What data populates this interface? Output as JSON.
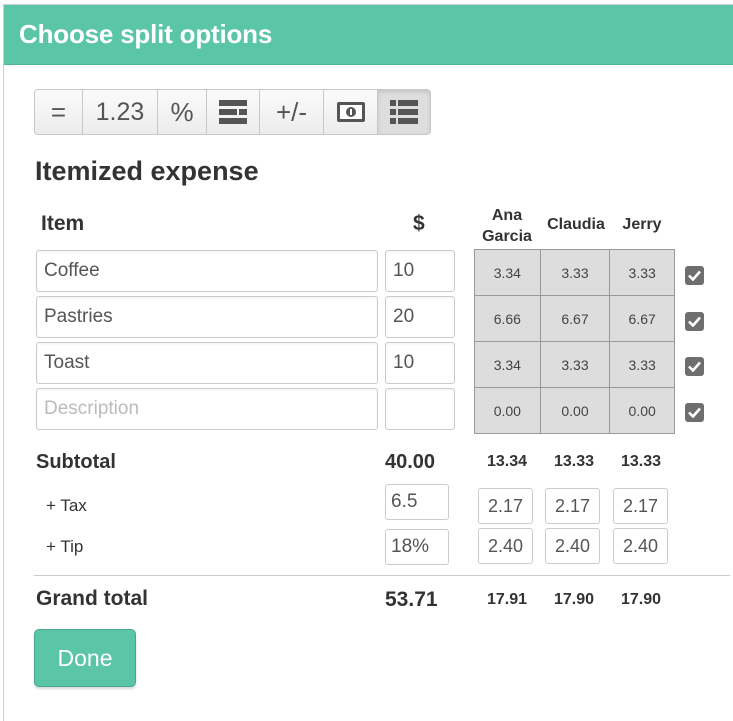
{
  "header": {
    "title": "Choose split options"
  },
  "toolbar": {
    "buttons": [
      {
        "label": "=",
        "icon": "equal-split-icon"
      },
      {
        "label": "1.23",
        "icon": "exact-amounts-icon"
      },
      {
        "label": "%",
        "icon": "percent-icon"
      },
      {
        "label": "",
        "icon": "shares-icon"
      },
      {
        "label": "+/-",
        "icon": "adjustment-icon"
      },
      {
        "label": "",
        "icon": "money-bill-icon"
      },
      {
        "label": "",
        "icon": "itemized-list-icon",
        "active": true
      }
    ]
  },
  "section_title": "Itemized expense",
  "table": {
    "headers": {
      "item": "Item",
      "amount": "$"
    },
    "people": [
      {
        "line1": "Ana",
        "line2": "Garcia"
      },
      {
        "line1": "",
        "line2": "Claudia"
      },
      {
        "line1": "",
        "line2": "Jerry"
      }
    ],
    "rows": [
      {
        "description": "Coffee",
        "amount": "10",
        "shares": [
          "3.34",
          "3.33",
          "3.33"
        ],
        "checked": true
      },
      {
        "description": "Pastries",
        "amount": "20",
        "shares": [
          "6.66",
          "6.67",
          "6.67"
        ],
        "checked": true
      },
      {
        "description": "Toast",
        "amount": "10",
        "shares": [
          "3.34",
          "3.33",
          "3.33"
        ],
        "checked": true
      },
      {
        "description": "",
        "amount": "",
        "shares": [
          "0.00",
          "0.00",
          "0.00"
        ],
        "checked": true
      }
    ],
    "description_placeholder": "Description"
  },
  "subtotal": {
    "label": "Subtotal",
    "amount": "40.00",
    "shares": [
      "13.34",
      "13.33",
      "13.33"
    ]
  },
  "tax": {
    "label": "+ Tax",
    "value": "6.5",
    "shares": [
      "2.17",
      "2.17",
      "2.17"
    ]
  },
  "tip": {
    "label": "+ Tip",
    "value": "18%",
    "shares": [
      "2.40",
      "2.40",
      "2.40"
    ]
  },
  "grand_total": {
    "label": "Grand total",
    "amount": "53.71",
    "shares": [
      "17.91",
      "17.90",
      "17.90"
    ]
  },
  "done_label": "Done",
  "colors": {
    "header": "#5bc5a7",
    "button": "#5bc5a7",
    "grid": "#dddddd",
    "checkbox": "#6e6e6e"
  }
}
